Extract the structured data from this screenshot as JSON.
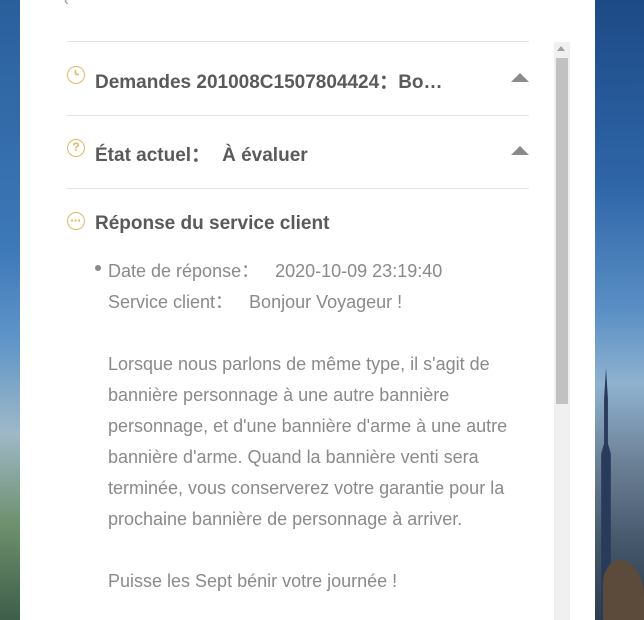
{
  "sections": {
    "request": {
      "label": "Demandes 201008C1507804424",
      "sep": "：",
      "value": "Bo…",
      "icon": "clock-icon"
    },
    "status": {
      "label": "État actuel",
      "sep": "：",
      "value": "À évaluer",
      "icon": "question-circle-icon"
    },
    "response_header": {
      "label": "Réponse du service client",
      "icon": "more-circle-icon"
    }
  },
  "response": {
    "date_label": "Date de réponse：",
    "date_value": "2020-10-09 23:19:40",
    "agent_label": "Service client：",
    "agent_value": "Bonjour Voyageur !",
    "paragraph_1": "Lorsque nous parlons de même type, il s'agit de bannière personnage à une autre bannière personnage, et d'une bannière d'arme à une autre bannière d'arme. Quand la bannière venti sera terminée, vous conserverez votre garantie pour la prochaine bannière de personnage à arriver.",
    "paragraph_2": "Puisse les Sept bénir votre journée !"
  },
  "colors": {
    "accent_icon": "#e0b866",
    "title_text": "#5a5a5a",
    "body_text": "#8a8a8a"
  }
}
